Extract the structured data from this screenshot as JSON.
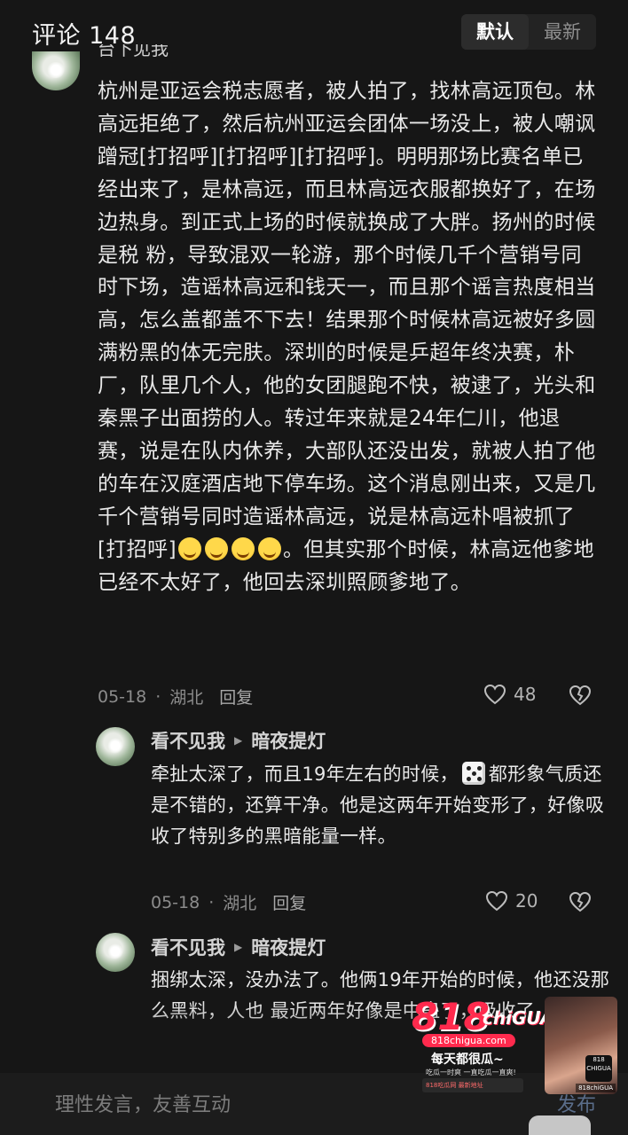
{
  "header": {
    "title": "评论 148",
    "sort_default": "默认",
    "sort_latest": "最新"
  },
  "main_comment": {
    "text_a": "杭州是亚运会税志愿者，被人拍了，找林高远顶包。林高远拒绝了，然后杭州亚运会团体一场没上，被人嘲讽蹭冠[打招呼][打招呼][打招呼]。明明那场比赛名单已经出来了，是林高远，而且林高远衣服都换好了，在场边热身。到正式上场的时候就换成了大胖。扬州的时候是税 粉，导致混双一轮游，那个时候几千个营销号同时下场，造谣林高远和钱天一，而且那个谣言热度相当高，怎么盖都盖不下去！结果那个时候林高远被好多圆满粉黑的体无完肤。深圳的时候是乒超年终决赛，朴厂，队里几个人，他的女团腿跑不快，被逮了，光头和秦黑子出面捞的人。转过年来就是24年仁川，他退赛，说是在队内休养，大部队还没出发，就被人拍了他的车在汉庭酒店地下停车场。这个消息刚出来，又是几千个营销号同时造谣林高远，说是林高远朴唱被抓了[打招呼]",
    "text_b": "。但其实那个时候，林高远他爹地已经不太好了，他回去深圳照顾爹地了。",
    "date": "05-18",
    "location": "湖北",
    "reply_label": "回复",
    "likes": "48"
  },
  "replies": [
    {
      "user": "看不见我",
      "target": "暗夜提灯",
      "text_a": "牵扯太深了，而且19年左右的时候，",
      "text_b": "都形象气质还是不错的，还算干净。他是这两年开始变形了，好像吸收了特别多的黑暗能量一样。",
      "date": "05-18",
      "location": "湖北",
      "reply_label": "回复",
      "likes": "20"
    },
    {
      "user": "看不见我",
      "target": "暗夜提灯",
      "text": "捆绑太深，没办法了。他俩19年开始的时候，他还没那么黑料，人也 最近两年好像是中蛊了，吸收了"
    }
  ],
  "bottom": {
    "placeholder": "理性发言，友善互动",
    "send": "发布"
  },
  "watermark": {
    "brand_num": "818",
    "brand_word": "chiGUA",
    "domain": "818chigua.com",
    "slogan": "每天都很瓜~",
    "sub": "吃瓜一时爽 一直吃瓜一直爽!",
    "badge": "818吃瓜网 最新地址",
    "photo_tag": "818 CHIGUA",
    "photo_caption": "818chiGUA"
  },
  "colors": {
    "background": "#161616",
    "text": "#e9e9e9",
    "meta": "#8c8c8c",
    "brand": "#ff2a4d"
  },
  "icons": {
    "like": "heart-outline-icon",
    "dislike": "broken-heart-icon",
    "reply_arrow": "triangle-right-icon",
    "emoji_laugh": "rofl-emoji-icon",
    "dice": "dice-emoji-icon"
  }
}
